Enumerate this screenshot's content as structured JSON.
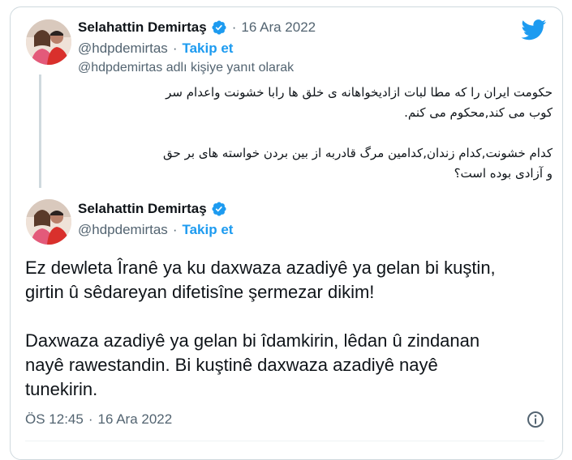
{
  "quoted": {
    "author_name": "Selahattin Demirtaş",
    "time": "16 Ara 2022",
    "handle": "@hdpdemirtas",
    "follow_label": "Takip et",
    "reply_note": "@hdpdemirtas adlı kişiye yanıt olarak",
    "text_lines": [
      "حکومت ایران را که مطا لبات ازادیخواهانه ی خلق ها رابا خشونت واعدام سر",
      "کوب می کند,محکوم می کنم.",
      "",
      "کدام خشونت,کدام زندان,کدامین مرگ قادربه از بین بردن خواسته های بر حق",
      "و آزادی بوده است؟"
    ]
  },
  "main": {
    "author_name": "Selahattin Demirtaş",
    "handle": "@hdpdemirtas",
    "follow_label": "Takip et",
    "text_lines": [
      "Ez dewleta Îranê ya ku daxwaza azadiyê ya gelan bi kuştin,",
      "girtin û  sêdareyan difetisîne şermezar dikim!",
      "",
      "Daxwaza azadiyê ya gelan bi îdamkirin, lêdan û zindanan",
      "nayê rawestandin. Bi kuştinê daxwaza azadiyê nayê",
      "tunekirin."
    ],
    "time": "ÖS 12:45",
    "date": "16 Ara 2022"
  },
  "icons": {
    "brand": "twitter-bird-icon",
    "verified": "verified-badge-icon",
    "info": "info-icon"
  },
  "colors": {
    "accent": "#1d9bf0",
    "secondary_text": "#536471",
    "border": "#cfd9de"
  }
}
